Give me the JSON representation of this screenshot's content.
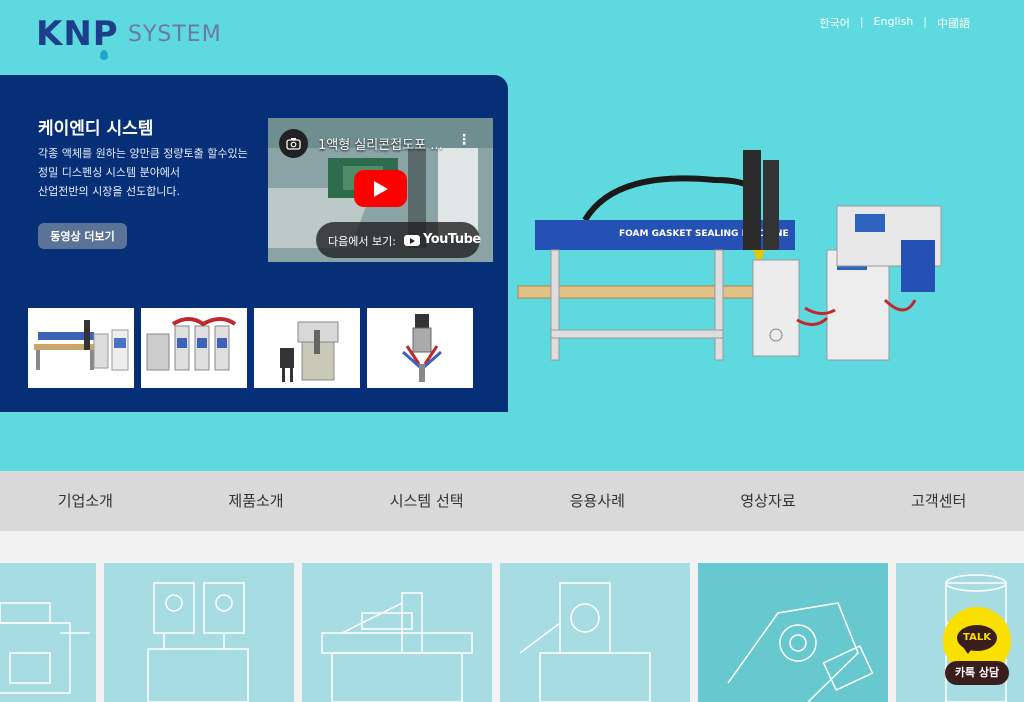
{
  "logo": {
    "brand": "KNP",
    "suffix": "SYSTEM"
  },
  "language": [
    {
      "label": "한국어"
    },
    {
      "label": "English"
    },
    {
      "label": "中國語"
    }
  ],
  "language_separator": "|",
  "hero": {
    "title": "케이엔디 시스템",
    "description_lines": [
      "각종 액체를 원하는 양만큼 정량토출 할수있는",
      "정밀 디스펜싱 시스템 분야에서",
      "산업전반의 시장을 선도합니다."
    ],
    "more_button": "동영상 더보기",
    "video": {
      "title": "1액형 실리콘접도포 ...",
      "watch_on": "다음에서 보기:",
      "platform": "YouTube"
    },
    "machine_label": "FOAM  GASKET SEALING MACHINE"
  },
  "nav": [
    {
      "label": "기업소개"
    },
    {
      "label": "제품소개"
    },
    {
      "label": "시스템 선택"
    },
    {
      "label": "응용사례"
    },
    {
      "label": "영상자료"
    },
    {
      "label": "고객센터"
    }
  ],
  "kakao": {
    "bubble": "TALK",
    "label": "카톡 상담"
  },
  "colors": {
    "hero_bg": "#5ed9df",
    "panel_bg": "#062f78",
    "nav_bg": "#d9d9d9",
    "card_bg": "#a6dce2",
    "kakao_yellow": "#f9e000"
  }
}
